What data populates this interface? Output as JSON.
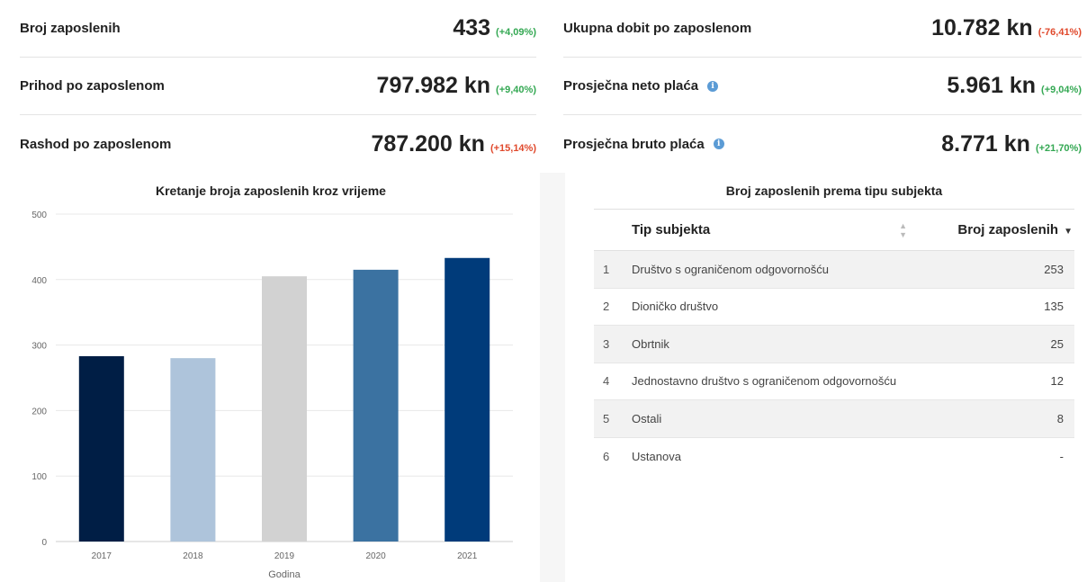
{
  "stats_left": [
    {
      "label": "Broj zaposlenih",
      "value": "433",
      "change": "(+4,09%)",
      "trend": "positive"
    },
    {
      "label": "Prihod po zaposlenom",
      "value": "797.982 kn",
      "change": "(+9,40%)",
      "trend": "positive"
    },
    {
      "label": "Rashod po zaposlenom",
      "value": "787.200 kn",
      "change": "(+15,14%)",
      "trend": "negative"
    }
  ],
  "stats_right": [
    {
      "label": "Ukupna dobit po zaposlenom",
      "value": "10.782 kn",
      "change": "(-76,41%)",
      "trend": "negative",
      "info": false
    },
    {
      "label": "Prosječna neto plaća",
      "value": "5.961 kn",
      "change": "(+9,04%)",
      "trend": "positive",
      "info": true
    },
    {
      "label": "Prosječna bruto plaća",
      "value": "8.771 kn",
      "change": "(+21,70%)",
      "trend": "positive",
      "info": true
    }
  ],
  "icons": {
    "info": "info-icon",
    "sort": "sort-icon",
    "sort_desc": "sort-desc-icon"
  },
  "colors": {
    "positive": "#34a853",
    "negative": "#e0492c",
    "info": "#5b9bd5"
  },
  "chart_data": {
    "type": "bar",
    "title": "Kretanje broja zaposlenih kroz vrijeme",
    "xlabel": "Godina",
    "ylabel": "",
    "categories": [
      "2017",
      "2018",
      "2019",
      "2020",
      "2021"
    ],
    "values": [
      283,
      280,
      405,
      415,
      433
    ],
    "colors": [
      "#001e45",
      "#aec4db",
      "#d2d2d2",
      "#3b72a1",
      "#003b7a"
    ],
    "ylim": [
      0,
      500
    ],
    "yticks": [
      0,
      100,
      200,
      300,
      400,
      500
    ],
    "grid": true,
    "legend": "none"
  },
  "table": {
    "title": "Broj zaposlenih prema tipu subjekta",
    "columns": {
      "type": "Tip subjekta",
      "count": "Broj zaposlenih"
    },
    "rows": [
      {
        "n": "1",
        "type": "Društvo s ograničenom odgovornošću",
        "count": "253"
      },
      {
        "n": "2",
        "type": "Dioničko društvo",
        "count": "135"
      },
      {
        "n": "3",
        "type": "Obrtnik",
        "count": "25"
      },
      {
        "n": "4",
        "type": "Jednostavno društvo s ograničenom odgovornošću",
        "count": "12"
      },
      {
        "n": "5",
        "type": "Ostali",
        "count": "8"
      },
      {
        "n": "6",
        "type": "Ustanova",
        "count": "-"
      }
    ]
  }
}
